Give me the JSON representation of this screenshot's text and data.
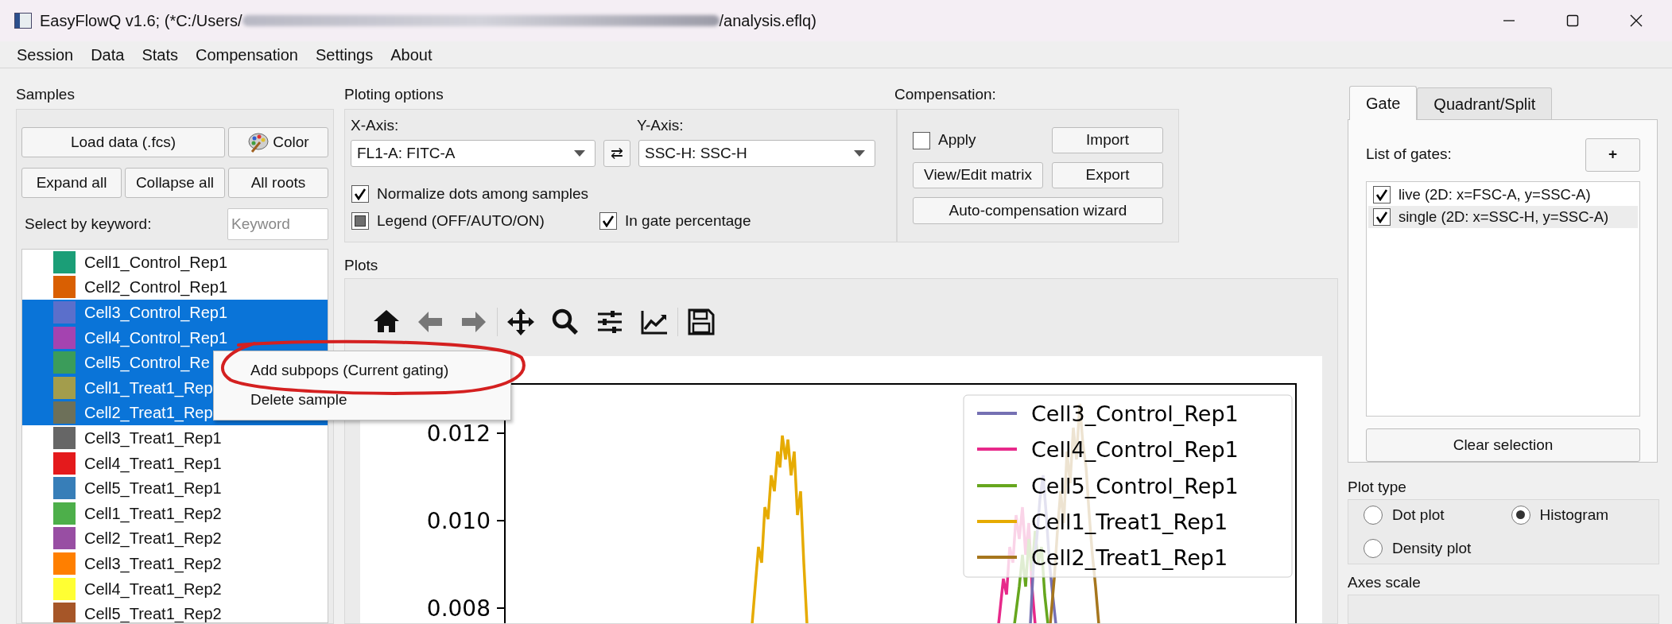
{
  "window": {
    "title_start": "EasyFlowQ v1.6; (*C:/Users/",
    "title_end": "/analysis.eflq)"
  },
  "menu": [
    "Session",
    "Data",
    "Stats",
    "Compensation",
    "Settings",
    "About"
  ],
  "samples": {
    "title": "Samples",
    "load_button": "Load data (.fcs)",
    "color_button": "Color",
    "expand_button": "Expand all",
    "collapse_button": "Collapse all",
    "roots_button": "All roots",
    "keyword_label": "Select by keyword:",
    "keyword_placeholder": "Keyword",
    "items": [
      {
        "name": "Cell1_Control_Rep1",
        "color": "#1b9e77",
        "selected": false
      },
      {
        "name": "Cell2_Control_Rep1",
        "color": "#d95f02",
        "selected": false
      },
      {
        "name": "Cell3_Control_Rep1",
        "color": "#5b6fcb",
        "selected": true
      },
      {
        "name": "Cell4_Control_Rep1",
        "color": "#a443b0",
        "selected": true
      },
      {
        "name": "Cell5_Control_Re",
        "color": "#3b9c5a",
        "selected": true
      },
      {
        "name": "Cell1_Treat1_Rep",
        "color": "#a39d4c",
        "selected": true
      },
      {
        "name": "Cell2_Treat1_Rep",
        "color": "#6d7059",
        "selected": true
      },
      {
        "name": "Cell3_Treat1_Rep1",
        "color": "#666666",
        "selected": false
      },
      {
        "name": "Cell4_Treat1_Rep1",
        "color": "#e41a1c",
        "selected": false
      },
      {
        "name": "Cell5_Treat1_Rep1",
        "color": "#377eb8",
        "selected": false
      },
      {
        "name": "Cell1_Treat1_Rep2",
        "color": "#4daf4a",
        "selected": false
      },
      {
        "name": "Cell2_Treat1_Rep2",
        "color": "#984ea3",
        "selected": false
      },
      {
        "name": "Cell3_Treat1_Rep2",
        "color": "#ff7f00",
        "selected": false
      },
      {
        "name": "Cell4_Treat1_Rep2",
        "color": "#ffff33",
        "selected": false
      },
      {
        "name": "Cell5_Treat1_Rep2",
        "color": "#a65628",
        "selected": false
      }
    ]
  },
  "plotting_options": {
    "title": "Ploting options",
    "x_label": "X-Axis:",
    "x_value": "FL1-A: FITC-A",
    "swap_button": "⇄",
    "y_label": "Y-Axis:",
    "y_value": "SSC-H: SSC-H",
    "checks": [
      {
        "label": "Normalize dots among samples",
        "checked": true
      },
      {
        "label": "Legend (OFF/AUTO/ON)",
        "partial": true
      },
      {
        "label": "In gate percentage",
        "checked": true
      }
    ]
  },
  "compensation": {
    "title": "Compensation:",
    "apply": {
      "label": "Apply",
      "checked": false
    },
    "import_button": "Import",
    "view_button": "View/Edit matrix",
    "export_button": "Export",
    "wizard_button": "Auto-compensation wizard"
  },
  "plots": {
    "title": "Plots",
    "y_tick_labels": [
      "0.012",
      "0.010",
      "0.008"
    ],
    "legend": [
      {
        "name": "Cell3_Control_Rep1",
        "color": "#7570b3"
      },
      {
        "name": "Cell4_Control_Rep1",
        "color": "#e7298a"
      },
      {
        "name": "Cell5_Control_Rep1",
        "color": "#66a61e"
      },
      {
        "name": "Cell1_Treat1_Rep1",
        "color": "#e6ab02"
      },
      {
        "name": "Cell2_Treat1_Rep1",
        "color": "#a6761d"
      }
    ]
  },
  "context_menu": {
    "items": [
      "Add subpops (Current gating)",
      "Delete sample"
    ]
  },
  "gate_panel": {
    "tabs": [
      {
        "label": "Gate",
        "selected": true
      },
      {
        "label": "Quadrant/Split",
        "selected": false
      }
    ],
    "list_label": "List of gates:",
    "add_button": "+",
    "gates": [
      {
        "label": "live (2D: x=FSC-A, y=SSC-A)",
        "checked": true,
        "selected": false
      },
      {
        "label": "single (2D: x=SSC-H, y=SSC-A)",
        "checked": true,
        "selected": true
      }
    ],
    "clear_button": "Clear selection"
  },
  "plot_type": {
    "title": "Plot type",
    "options": [
      {
        "label": "Dot plot",
        "selected": false
      },
      {
        "label": "Histogram",
        "selected": true
      },
      {
        "label": "Density plot",
        "selected": false
      }
    ]
  },
  "axes_scale": {
    "title": "Axes scale"
  }
}
